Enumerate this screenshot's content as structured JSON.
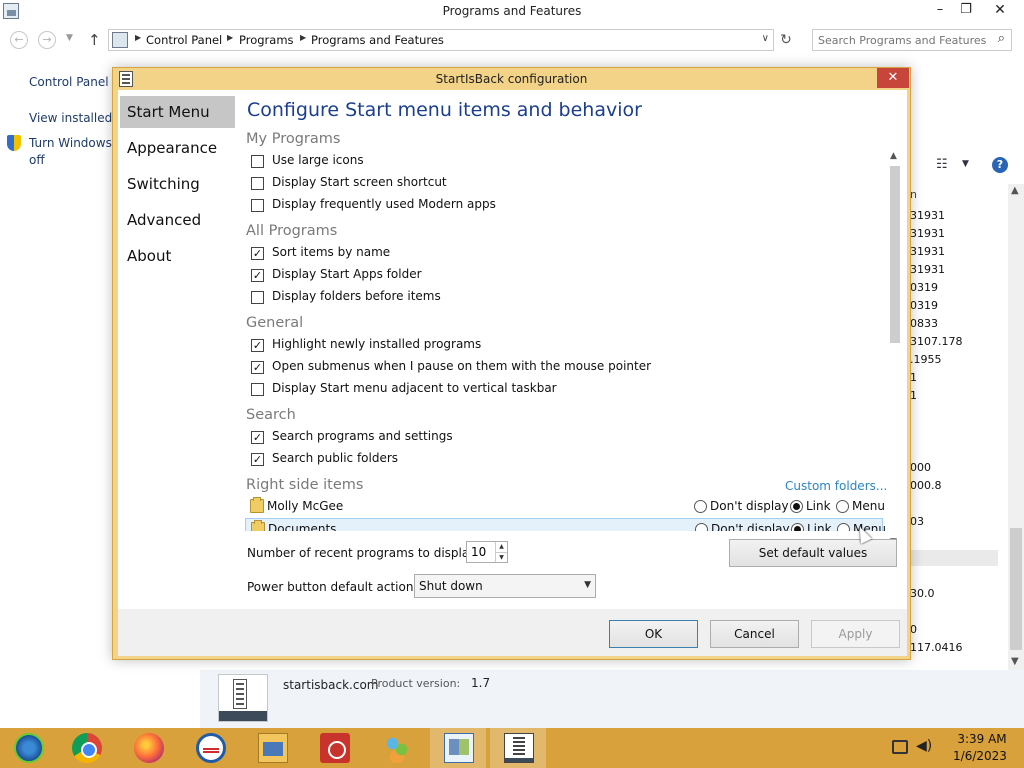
{
  "background_window": {
    "title": "Programs and Features",
    "controls": {
      "minimize": "–",
      "maximize": "❐",
      "close": "✕"
    },
    "breadcrumb": [
      "Control Panel",
      "Programs",
      "Programs and Features"
    ],
    "search_placeholder": "Search Programs and Features",
    "sidebar_links": [
      "Control Panel H",
      "View installed",
      "Turn Windows",
      "off"
    ],
    "list_column_header": "n",
    "list_versions": [
      "31931",
      "31931",
      "31931",
      "31931",
      "0319",
      "0319",
      "0833",
      "3107.178",
      ".1955",
      "1",
      "1",
      "000",
      "000.8",
      "03",
      "30.0",
      "0",
      "117.0416"
    ],
    "details": {
      "company": "startisback.com",
      "version_label": "Product version:",
      "version": "1.7"
    }
  },
  "dialog": {
    "title": "StartIsBack configuration",
    "close": "✕",
    "nav": [
      "Start Menu",
      "Appearance",
      "Switching",
      "Advanced",
      "About"
    ],
    "active_nav": "Start Menu",
    "heading": "Configure Start menu items and behavior",
    "sections": [
      {
        "title": "My Programs",
        "options": [
          {
            "label": "Use large icons",
            "checked": false
          },
          {
            "label": "Display Start screen shortcut",
            "checked": false
          },
          {
            "label": "Display frequently used Modern apps",
            "checked": false
          }
        ]
      },
      {
        "title": "All Programs",
        "options": [
          {
            "label": "Sort items by name",
            "checked": true
          },
          {
            "label": "Display Start Apps folder",
            "checked": true
          },
          {
            "label": "Display folders before items",
            "checked": false
          }
        ]
      },
      {
        "title": "General",
        "options": [
          {
            "label": "Highlight newly installed programs",
            "checked": true
          },
          {
            "label": "Open submenus when I pause on them with the mouse pointer",
            "checked": true
          },
          {
            "label": "Display Start menu adjacent to vertical taskbar",
            "checked": false
          }
        ]
      },
      {
        "title": "Search",
        "options": [
          {
            "label": "Search programs and settings",
            "checked": true
          },
          {
            "label": "Search public folders",
            "checked": true
          }
        ]
      }
    ],
    "right_side": {
      "title": "Right side items",
      "custom_link": "Custom folders...",
      "radio_labels": [
        "Don't display",
        "Link",
        "Menu"
      ],
      "items": [
        {
          "name": "Molly McGee",
          "selected_option": "Link"
        },
        {
          "name": "Documents",
          "selected_option": "Link"
        }
      ]
    },
    "recent_label": "Number of recent programs to display:",
    "recent_value": "10",
    "set_default": "Set default values",
    "power_label": "Power button default action:",
    "power_value": "Shut down",
    "buttons": {
      "ok": "OK",
      "cancel": "Cancel",
      "apply": "Apply"
    }
  },
  "taskbar": {
    "clock": {
      "time": "3:39 AM",
      "date": "1/6/2023"
    }
  },
  "colors": {
    "dialog_frame": "#f3d387",
    "taskbar": "#d9a13b",
    "heading": "#1b3f8e",
    "link": "#2c85c4"
  }
}
